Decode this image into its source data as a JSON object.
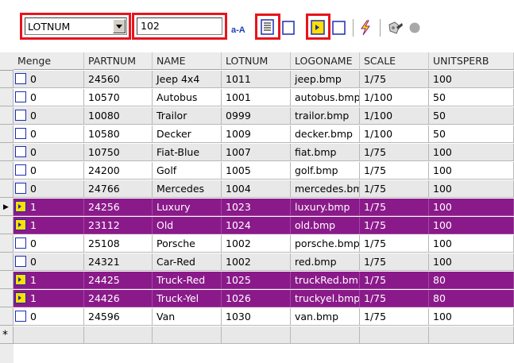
{
  "toolbar": {
    "field_select_value": "LOTNUM",
    "search_value": "102",
    "icons": [
      "sort-az-icon",
      "detail-view-icon",
      "checkbox-icon",
      "selected-filter-icon",
      "checkbox-icon",
      "lightning-icon",
      "dropper-icon",
      "circle-icon"
    ],
    "sort_label": "a-A"
  },
  "grid": {
    "columns": [
      "Menge",
      "PARTNUM",
      "NAME",
      "LOTNUM",
      "LOGONAME",
      "SCALE",
      "UNITSPERB"
    ],
    "rows": [
      {
        "menge": "0",
        "partnum": "24560",
        "name": "Jeep 4x4",
        "lotnum": "1011",
        "logoname": "jeep.bmp",
        "scale": "1/75",
        "units": "100",
        "selected": false,
        "checked": false
      },
      {
        "menge": "0",
        "partnum": "10570",
        "name": "Autobus",
        "lotnum": "1001",
        "logoname": "autobus.bmp",
        "scale": "1/100",
        "units": "50",
        "selected": false,
        "checked": false
      },
      {
        "menge": "0",
        "partnum": "10080",
        "name": "Trailor",
        "lotnum": "0999",
        "logoname": "trailor.bmp",
        "scale": "1/100",
        "units": "50",
        "selected": false,
        "checked": false
      },
      {
        "menge": "0",
        "partnum": "10580",
        "name": "Decker",
        "lotnum": "1009",
        "logoname": "decker.bmp",
        "scale": "1/100",
        "units": "50",
        "selected": false,
        "checked": false
      },
      {
        "menge": "0",
        "partnum": "10750",
        "name": "Fiat-Blue",
        "lotnum": "1007",
        "logoname": "fiat.bmp",
        "scale": "1/75",
        "units": "100",
        "selected": false,
        "checked": false
      },
      {
        "menge": "0",
        "partnum": "24200",
        "name": "Golf",
        "lotnum": "1005",
        "logoname": "golf.bmp",
        "scale": "1/75",
        "units": "100",
        "selected": false,
        "checked": false
      },
      {
        "menge": "0",
        "partnum": "24766",
        "name": "Mercedes",
        "lotnum": "1004",
        "logoname": "mercedes.bm",
        "scale": "1/75",
        "units": "100",
        "selected": false,
        "checked": false
      },
      {
        "menge": "1",
        "partnum": "24256",
        "name": "Luxury",
        "lotnum": "1023",
        "logoname": "luxury.bmp",
        "scale": "1/75",
        "units": "100",
        "selected": true,
        "checked": true
      },
      {
        "menge": "1",
        "partnum": "23112",
        "name": "Old",
        "lotnum": "1024",
        "logoname": "old.bmp",
        "scale": "1/75",
        "units": "100",
        "selected": true,
        "checked": true
      },
      {
        "menge": "0",
        "partnum": "25108",
        "name": "Porsche",
        "lotnum": "1002",
        "logoname": "porsche.bmp",
        "scale": "1/75",
        "units": "100",
        "selected": false,
        "checked": false
      },
      {
        "menge": "0",
        "partnum": "24321",
        "name": "Car-Red",
        "lotnum": "1002",
        "logoname": "red.bmp",
        "scale": "1/75",
        "units": "100",
        "selected": false,
        "checked": false
      },
      {
        "menge": "1",
        "partnum": "24425",
        "name": "Truck-Red",
        "lotnum": "1025",
        "logoname": "truckRed.bm",
        "scale": "1/75",
        "units": "80",
        "selected": true,
        "checked": true
      },
      {
        "menge": "1",
        "partnum": "24426",
        "name": "Truck-Yel",
        "lotnum": "1026",
        "logoname": "truckyel.bmp",
        "scale": "1/75",
        "units": "80",
        "selected": true,
        "checked": true
      },
      {
        "menge": "0",
        "partnum": "24596",
        "name": "Van",
        "lotnum": "1030",
        "logoname": "van.bmp",
        "scale": "1/75",
        "units": "100",
        "selected": false,
        "checked": false
      }
    ],
    "new_row_marker": "*",
    "current_row_marker": "▶",
    "current_row": 7
  },
  "colors": {
    "highlight": "#e8141c",
    "selected_row": "#8a1a8a",
    "checkbox_border": "#1c2eb0",
    "checkbox_checked": "#ffe000"
  }
}
